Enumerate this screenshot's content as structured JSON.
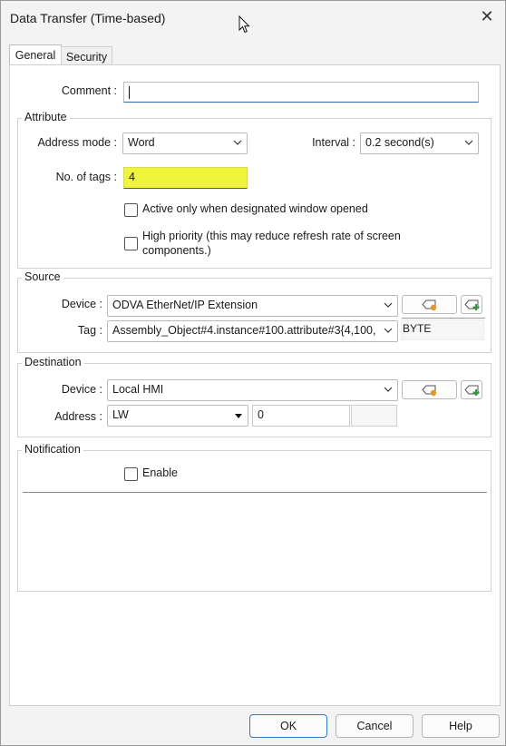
{
  "window": {
    "title": "Data Transfer (Time-based)"
  },
  "tabs": [
    {
      "label": "General",
      "active": true
    },
    {
      "label": "Security",
      "active": false
    }
  ],
  "general": {
    "comment_label": "Comment :",
    "comment_value": ""
  },
  "attribute": {
    "title": "Attribute",
    "address_mode_label": "Address mode :",
    "address_mode_value": "Word",
    "interval_label": "Interval :",
    "interval_value": "0.2 second(s)",
    "tags_label": "No. of tags :",
    "tags_value": "4",
    "active_only_label": "Active only when designated window opened",
    "high_priority_label": "High priority (this may reduce refresh rate of screen components.)"
  },
  "source": {
    "title": "Source",
    "device_label": "Device :",
    "device_value": "ODVA EtherNet/IP Extension",
    "tag_label": "Tag :",
    "tag_value": "Assembly_Object#4.instance#100.attribute#3{4,100,",
    "type_value": "BYTE"
  },
  "destination": {
    "title": "Destination",
    "device_label": "Device :",
    "device_value": "Local HMI",
    "address_label": "Address :",
    "address_type_value": "LW",
    "address_value": "0",
    "extra_value": ""
  },
  "notification": {
    "title": "Notification",
    "enable_label": "Enable"
  },
  "buttons": {
    "ok": "OK",
    "cancel": "Cancel",
    "help": "Help"
  },
  "colors": {
    "highlight_field": "#f0f53b",
    "focus_border": "#2f6fae",
    "default_button_border": "#3b78c4"
  },
  "icons": [
    "close-icon",
    "cursor-arrow-icon",
    "chevron-down-icon",
    "tag-settings-icon",
    "tag-add-icon",
    "dropdown-triangle-icon"
  ]
}
